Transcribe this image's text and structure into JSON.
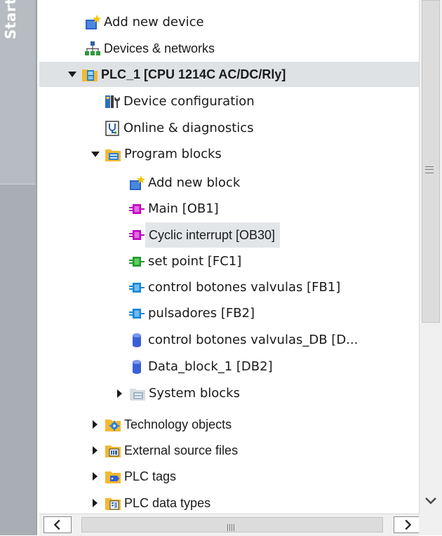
{
  "sidebar": {
    "start_tab_label": "Start"
  },
  "tree": {
    "items": [
      {
        "label": "Add new device",
        "icon": "add-new-device-icon"
      },
      {
        "label": "Devices & networks",
        "icon": "devices-networks-icon"
      },
      {
        "label": "PLC_1 [CPU 1214C AC/DC/Rly]",
        "icon": "plc-folder-icon",
        "expanded": true
      },
      {
        "label": "Device configuration",
        "icon": "device-configuration-icon"
      },
      {
        "label": "Online & diagnostics",
        "icon": "online-diagnostics-icon"
      },
      {
        "label": "Program blocks",
        "icon": "program-blocks-folder-icon",
        "expanded": true
      },
      {
        "label": "Add new block",
        "icon": "add-new-block-icon"
      },
      {
        "label": "Main [OB1]",
        "icon": "ob-block-icon"
      },
      {
        "label": "Cyclic interrupt [OB30]",
        "icon": "ob-block-icon",
        "selected": true
      },
      {
        "label": "set point [FC1]",
        "icon": "fc-block-icon"
      },
      {
        "label": "control botones valvulas [FB1]",
        "icon": "fb-block-icon"
      },
      {
        "label": "pulsadores [FB2]",
        "icon": "fb-block-icon"
      },
      {
        "label": "control botones valvulas_DB [D...",
        "icon": "db-block-icon"
      },
      {
        "label": "Data_block_1 [DB2]",
        "icon": "db-block-icon"
      },
      {
        "label": "System blocks",
        "icon": "system-blocks-folder-icon",
        "expanded": false
      },
      {
        "label": "Technology objects",
        "icon": "technology-objects-folder-icon",
        "expanded": false
      },
      {
        "label": "External source files",
        "icon": "external-source-files-folder-icon",
        "expanded": false
      },
      {
        "label": "PLC tags",
        "icon": "plc-tags-folder-icon",
        "expanded": false
      },
      {
        "label": "PLC data types",
        "icon": "plc-data-types-folder-icon",
        "expanded": false
      }
    ]
  },
  "colors": {
    "sidebar_strip": "#a8aeb3",
    "selected_row": "#dfe2e5",
    "ob_block": "#c000c0",
    "fc_block": "#20a020",
    "fb_block": "#1a8fe0",
    "db_block": "#3a5fd8",
    "folder": "#f2b933"
  }
}
